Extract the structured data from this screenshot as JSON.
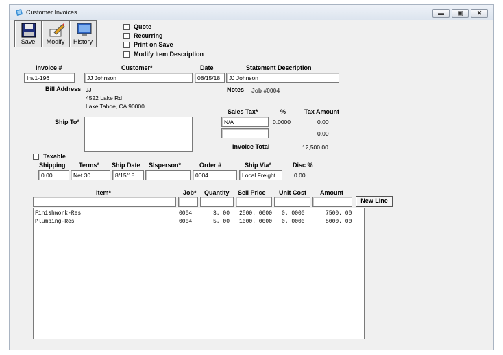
{
  "window": {
    "title": "Customer Invoices"
  },
  "toolbar": {
    "save": "Save",
    "modify": "Modify",
    "history": "History"
  },
  "options": {
    "quote": "Quote",
    "recurring": "Recurring",
    "print_on_save": "Print on Save",
    "modify_desc": "Modify Item Description"
  },
  "header": {
    "invoice_label": "Invoice #",
    "invoice_value": "Inv1-196",
    "customer_label": "Customer*",
    "customer_value": "JJ Johnson",
    "date_label": "Date",
    "date_value": "08/15/18",
    "stmt_label": "Statement Description",
    "stmt_value": "JJ Johnson"
  },
  "bill": {
    "label": "Bill Address",
    "name": "JJ",
    "line1": "4522 Lake Rd",
    "line2": "Lake Tahoe, CA 90000"
  },
  "notes": {
    "label": "Notes",
    "value": "Job #0004"
  },
  "tax": {
    "sales_tax_label": "Sales Tax*",
    "pct_label": "%",
    "tax_amount_label": "Tax Amount",
    "row1_tax": "N/A",
    "row1_pct": "0.0000",
    "row1_amount": "0.00",
    "row2_tax": "",
    "row2_amount": "0.00",
    "total_label": "Invoice Total",
    "total_value": "12,500.00"
  },
  "ship_to": {
    "label": "Ship To*"
  },
  "taxable": {
    "label": "Taxable"
  },
  "shipping": {
    "shipping_label": "Shipping",
    "shipping_value": "0.00",
    "terms_label": "Terms*",
    "terms_value": "Net 30",
    "ship_date_label": "Ship Date",
    "ship_date_value": "8/15/18",
    "slsperson_label": "Slsperson*",
    "slsperson_value": "",
    "order_label": "Order #",
    "order_value": "0004",
    "ship_via_label": "Ship Via*",
    "ship_via_value": "Local Freight",
    "disc_label": "Disc %",
    "disc_value": "0.00"
  },
  "items": {
    "headers": {
      "item": "Item*",
      "job": "Job*",
      "quantity": "Quantity",
      "sell_price": "Sell Price",
      "unit_cost": "Unit Cost",
      "amount": "Amount"
    },
    "new_line": "New Line",
    "rows": [
      {
        "item": "Finishwork-Res",
        "job": "0004",
        "quantity": "3. 00",
        "sell_price": "2500. 0000",
        "unit_cost": "0. 0000",
        "amount": "7500. 00"
      },
      {
        "item": "Plumbing-Res",
        "job": "0004",
        "quantity": "5. 00",
        "sell_price": "1000. 0000",
        "unit_cost": "0. 0000",
        "amount": "5000. 00"
      }
    ]
  }
}
